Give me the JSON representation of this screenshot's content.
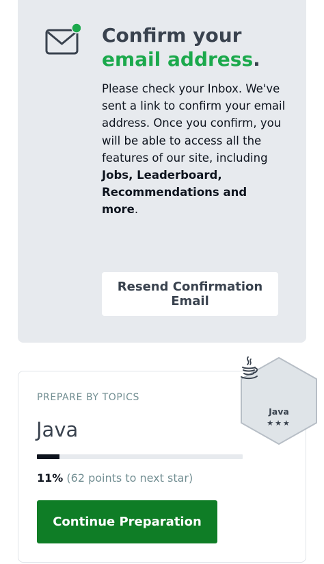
{
  "confirm": {
    "title_part1": "Confirm your",
    "title_accent": "email address",
    "title_end": ".",
    "body_intro": "Please check your Inbox. We've sent a link to confirm your email address. Once you confirm, you will be able to access all the features of our site, including ",
    "body_bold": "Jobs, Leaderboard, Recommendations and more",
    "body_end": ".",
    "resend_label": "Resend Confirmation Email",
    "icon": "mail-icon",
    "accent_color": "#1ba94c"
  },
  "topic": {
    "section_label": "PREPARE BY TOPICS",
    "name": "Java",
    "progress_percent": 11,
    "progress_label": "11%",
    "progress_detail": "(62 points to next star)",
    "continue_label": "Continue Preparation",
    "button_color": "#0f7d26"
  },
  "badge": {
    "label": "Java",
    "stars": "★★★",
    "icon": "java-icon"
  }
}
